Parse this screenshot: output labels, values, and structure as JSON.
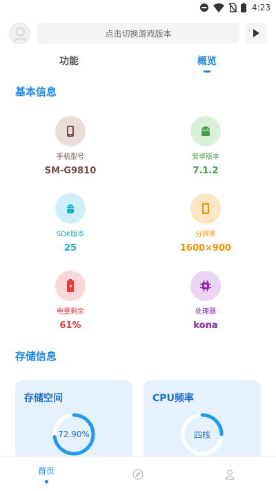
{
  "status_bar": {
    "time": "4:23"
  },
  "search": {
    "placeholder": "点击切换游戏版本"
  },
  "tabs": [
    {
      "label": "功能",
      "active": false
    },
    {
      "label": "概览",
      "active": true
    }
  ],
  "basic_info": {
    "title": "基本信息",
    "items": [
      {
        "label": "手机型号",
        "value": "SM-G9810",
        "icon": "phone-icon",
        "color": "#6d4c41",
        "bg": "#e8ddd8"
      },
      {
        "label": "安卓版本",
        "value": "7.1.2",
        "icon": "android-icon",
        "color": "#43a047",
        "bg": "#d9f1d8"
      },
      {
        "label": "SDK版本",
        "value": "25",
        "icon": "android-robot-icon",
        "color": "#1ab0d6",
        "bg": "#cdf0f8"
      },
      {
        "label": "分辨率",
        "value": "1600×900",
        "icon": "screen-icon",
        "color": "#f59300",
        "bg": "#ffe6c2"
      },
      {
        "label": "电量剩余",
        "value": "61%",
        "icon": "battery-icon",
        "color": "#e53935",
        "bg": "#fbd7d7"
      },
      {
        "label": "处理器",
        "value": "kona",
        "icon": "cpu-icon",
        "color": "#8e24aa",
        "bg": "#ecd5f3"
      }
    ]
  },
  "storage_info": {
    "title": "存储信息",
    "cards": [
      {
        "title": "存储空间",
        "gauge_text": "72.90%",
        "fraction": 0.729
      },
      {
        "title": "CPU频率",
        "gauge_text": "四核",
        "fraction": 0.25
      }
    ]
  },
  "bottom_nav": {
    "items": [
      {
        "label": "首页",
        "icon": "home",
        "active": true
      },
      {
        "label": "",
        "icon": "compass-icon",
        "active": false
      },
      {
        "label": "",
        "icon": "user-icon",
        "active": false
      }
    ]
  },
  "colors": {
    "accent": "#1e88e5",
    "card_bg": "#e5f2fd",
    "gauge": "#1e9af0"
  }
}
